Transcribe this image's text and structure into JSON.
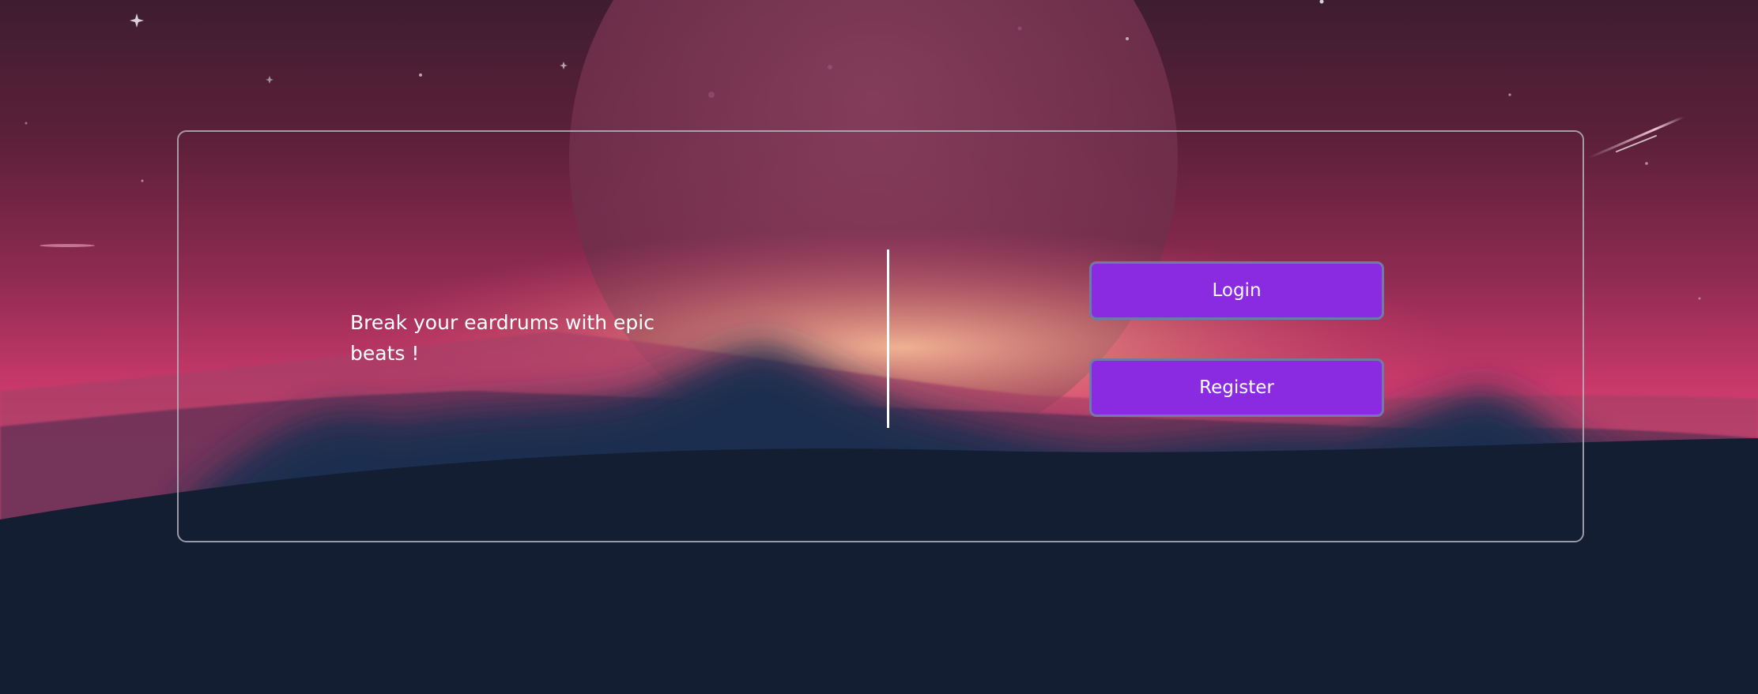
{
  "hero": {
    "tagline": "Break your eardrums with epic beats !"
  },
  "actions": {
    "login_label": "Login",
    "register_label": "Register"
  },
  "theme": {
    "button_color": "#8a2be2",
    "sky_top": "#3e1d30",
    "sky_horizon": "#e04876",
    "glow": "#f0a08a",
    "ground": "#141e33"
  },
  "icons": [
    "moon-icon",
    "star-icon",
    "shooting-star-icon"
  ]
}
